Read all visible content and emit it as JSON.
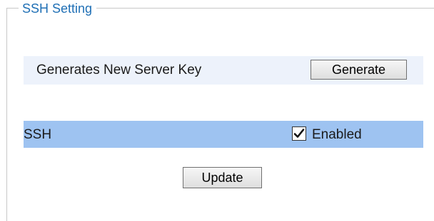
{
  "section": {
    "legend": "SSH Setting"
  },
  "server_key": {
    "label": "Generates New Server Key",
    "button_label": "Generate"
  },
  "ssh": {
    "label": "SSH",
    "checkbox_checked": true,
    "checkbox_label": "Enabled"
  },
  "actions": {
    "update_label": "Update"
  },
  "colors": {
    "legend_text": "#1f6fb5",
    "key_row_bg": "#edf2fb",
    "ssh_row_bg": "#9ec3f1"
  },
  "icons": {
    "checkbox_mark": "check-icon"
  }
}
